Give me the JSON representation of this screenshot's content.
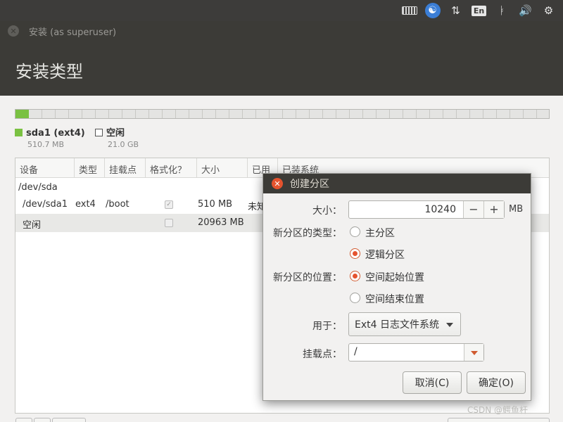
{
  "top_panel": {
    "icons": [
      "keyboard-icon",
      "accessibility-icon",
      "network-icon",
      "bluetooth-icon",
      "volume-icon",
      "gear-icon"
    ],
    "input_method": "En"
  },
  "window": {
    "title": "安装 (as superuser)",
    "page_title": "安装类型"
  },
  "legend": [
    {
      "name": "sda1 (ext4)",
      "size": "510.7 MB",
      "color": "#7ac142"
    },
    {
      "name": "空闲",
      "size": "21.0 GB",
      "color": "#ffffff"
    }
  ],
  "table": {
    "columns": [
      "设备",
      "类型",
      "挂载点",
      "格式化？",
      "大小",
      "已用",
      "已装系统"
    ],
    "rows": [
      {
        "device": "/dev/sda",
        "type": "",
        "mount": "",
        "format": "",
        "size": "",
        "used": ""
      },
      {
        "device": "/dev/sda1",
        "type": "ext4",
        "mount": "/boot",
        "format": "checked",
        "size": "510 MB",
        "used": "未知"
      },
      {
        "device": "空闲",
        "type": "",
        "mount": "",
        "format": "unchecked",
        "size": "20963 MB",
        "used": ""
      }
    ]
  },
  "dialog": {
    "title": "创建分区",
    "size_label": "大小：",
    "size_value": "10240",
    "size_minus": "−",
    "size_plus": "+",
    "size_unit": "MB",
    "type_label": "新分区的类型：",
    "type_primary": "主分区",
    "type_logical": "逻辑分区",
    "location_label": "新分区的位置：",
    "location_start": "空间起始位置",
    "location_end": "空间结束位置",
    "use_label": "用于：",
    "use_value": "Ext4 日志文件系统",
    "mount_label": "挂载点：",
    "mount_value": "/",
    "cancel": "取消(C)",
    "ok": "确定(O)",
    "selected_type": "逻辑分区",
    "selected_location": "空间起始位置"
  },
  "watermark": "CSDN @鳄鱼杆"
}
